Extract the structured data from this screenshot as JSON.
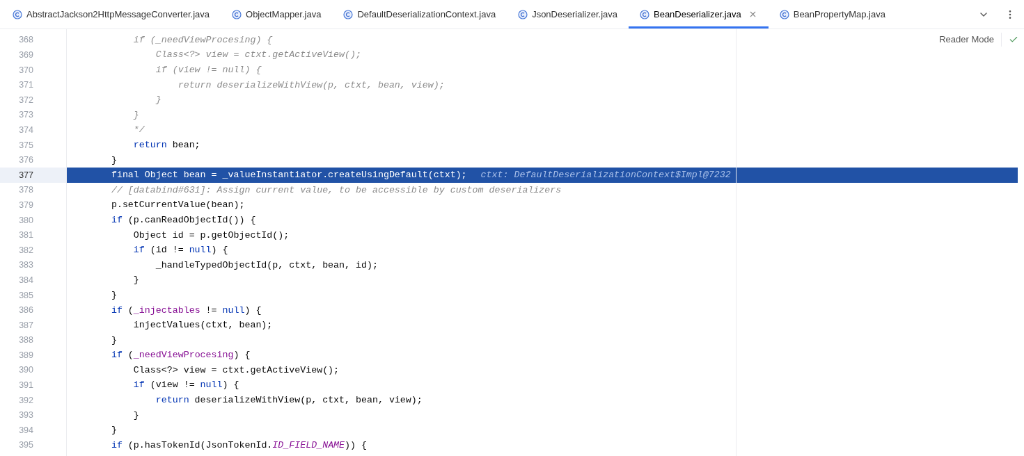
{
  "tabs": [
    {
      "label": "AbstractJackson2HttpMessageConverter.java",
      "selected": false
    },
    {
      "label": "ObjectMapper.java",
      "selected": false
    },
    {
      "label": "DefaultDeserializationContext.java",
      "selected": false
    },
    {
      "label": "JsonDeserializer.java",
      "selected": false
    },
    {
      "label": "BeanDeserializer.java",
      "selected": true
    },
    {
      "label": "BeanPropertyMap.java",
      "selected": false
    }
  ],
  "reader_mode": "Reader Mode",
  "lines": [
    {
      "number": "368",
      "selected": false,
      "segments": [
        {
          "kind": "disabled",
          "text": "        if (_needViewProcesing) {"
        }
      ]
    },
    {
      "number": "369",
      "selected": false,
      "segments": [
        {
          "kind": "disabled",
          "text": "            Class<?> view = ctxt.getActiveView();"
        }
      ]
    },
    {
      "number": "370",
      "selected": false,
      "segments": [
        {
          "kind": "disabled",
          "text": "            if (view != null) {"
        }
      ]
    },
    {
      "number": "371",
      "selected": false,
      "segments": [
        {
          "kind": "disabled",
          "text": "                return deserializeWithView(p, ctxt, bean, view);"
        }
      ]
    },
    {
      "number": "372",
      "selected": false,
      "segments": [
        {
          "kind": "disabled",
          "text": "            }"
        }
      ]
    },
    {
      "number": "373",
      "selected": false,
      "segments": [
        {
          "kind": "disabled",
          "text": "        }"
        }
      ]
    },
    {
      "number": "374",
      "selected": false,
      "segments": [
        {
          "kind": "disabled",
          "text": "        */"
        }
      ]
    },
    {
      "number": "375",
      "selected": false,
      "segments": [
        {
          "kind": "keyword",
          "text": "        return"
        },
        {
          "kind": "plain",
          "text": " bean;"
        }
      ]
    },
    {
      "number": "376",
      "selected": false,
      "segments": [
        {
          "kind": "plain",
          "text": "    }"
        }
      ]
    },
    {
      "number": "377",
      "selected": true,
      "segments": [
        {
          "kind": "plain",
          "text": "    final Object bean = _valueInstantiator.createUsingDefault(ctxt);"
        }
      ],
      "hint": "ctxt: DefaultDeserializationContext$Impl@7232"
    },
    {
      "number": "378",
      "selected": false,
      "segments": [
        {
          "kind": "comment",
          "text": "    // [databind#631]: Assign current value, to be accessible by custom deserializers"
        }
      ]
    },
    {
      "number": "379",
      "selected": false,
      "segments": [
        {
          "kind": "plain",
          "text": "    p.setCurrentValue(bean);"
        }
      ]
    },
    {
      "number": "380",
      "selected": false,
      "segments": [
        {
          "kind": "keyword",
          "text": "    if"
        },
        {
          "kind": "plain",
          "text": " (p.canReadObjectId()) {"
        }
      ]
    },
    {
      "number": "381",
      "selected": false,
      "segments": [
        {
          "kind": "plain",
          "text": "        Object id = p.getObjectId();"
        }
      ]
    },
    {
      "number": "382",
      "selected": false,
      "segments": [
        {
          "kind": "keyword",
          "text": "        if"
        },
        {
          "kind": "plain",
          "text": " (id != "
        },
        {
          "kind": "keyword",
          "text": "null"
        },
        {
          "kind": "plain",
          "text": ") {"
        }
      ]
    },
    {
      "number": "383",
      "selected": false,
      "segments": [
        {
          "kind": "plain",
          "text": "            _handleTypedObjectId(p, ctxt, bean, id);"
        }
      ]
    },
    {
      "number": "384",
      "selected": false,
      "segments": [
        {
          "kind": "plain",
          "text": "        }"
        }
      ]
    },
    {
      "number": "385",
      "selected": false,
      "segments": [
        {
          "kind": "plain",
          "text": "    }"
        }
      ]
    },
    {
      "number": "386",
      "selected": false,
      "segments": [
        {
          "kind": "keyword",
          "text": "    if"
        },
        {
          "kind": "plain",
          "text": " ("
        },
        {
          "kind": "field",
          "text": "_injectables"
        },
        {
          "kind": "plain",
          "text": " != "
        },
        {
          "kind": "keyword",
          "text": "null"
        },
        {
          "kind": "plain",
          "text": ") {"
        }
      ]
    },
    {
      "number": "387",
      "selected": false,
      "segments": [
        {
          "kind": "plain",
          "text": "        injectValues(ctxt, bean);"
        }
      ]
    },
    {
      "number": "388",
      "selected": false,
      "segments": [
        {
          "kind": "plain",
          "text": "    }"
        }
      ]
    },
    {
      "number": "389",
      "selected": false,
      "segments": [
        {
          "kind": "keyword",
          "text": "    if"
        },
        {
          "kind": "plain",
          "text": " ("
        },
        {
          "kind": "field",
          "text": "_needViewProcesing"
        },
        {
          "kind": "plain",
          "text": ") {"
        }
      ]
    },
    {
      "number": "390",
      "selected": false,
      "segments": [
        {
          "kind": "plain",
          "text": "        Class<?> view = ctxt.getActiveView();"
        }
      ]
    },
    {
      "number": "391",
      "selected": false,
      "segments": [
        {
          "kind": "keyword",
          "text": "        if"
        },
        {
          "kind": "plain",
          "text": " (view != "
        },
        {
          "kind": "keyword",
          "text": "null"
        },
        {
          "kind": "plain",
          "text": ") {"
        }
      ]
    },
    {
      "number": "392",
      "selected": false,
      "segments": [
        {
          "kind": "keyword",
          "text": "            return"
        },
        {
          "kind": "plain",
          "text": " deserializeWithView(p, ctxt, bean, view);"
        }
      ]
    },
    {
      "number": "393",
      "selected": false,
      "segments": [
        {
          "kind": "plain",
          "text": "        }"
        }
      ]
    },
    {
      "number": "394",
      "selected": false,
      "segments": [
        {
          "kind": "plain",
          "text": "    }"
        }
      ]
    },
    {
      "number": "395",
      "selected": false,
      "segments": [
        {
          "kind": "keyword",
          "text": "    if"
        },
        {
          "kind": "plain",
          "text": " (p.hasTokenId(JsonTokenId."
        },
        {
          "kind": "constant",
          "text": "ID_FIELD_NAME"
        },
        {
          "kind": "plain",
          "text": ")) {"
        }
      ]
    }
  ]
}
